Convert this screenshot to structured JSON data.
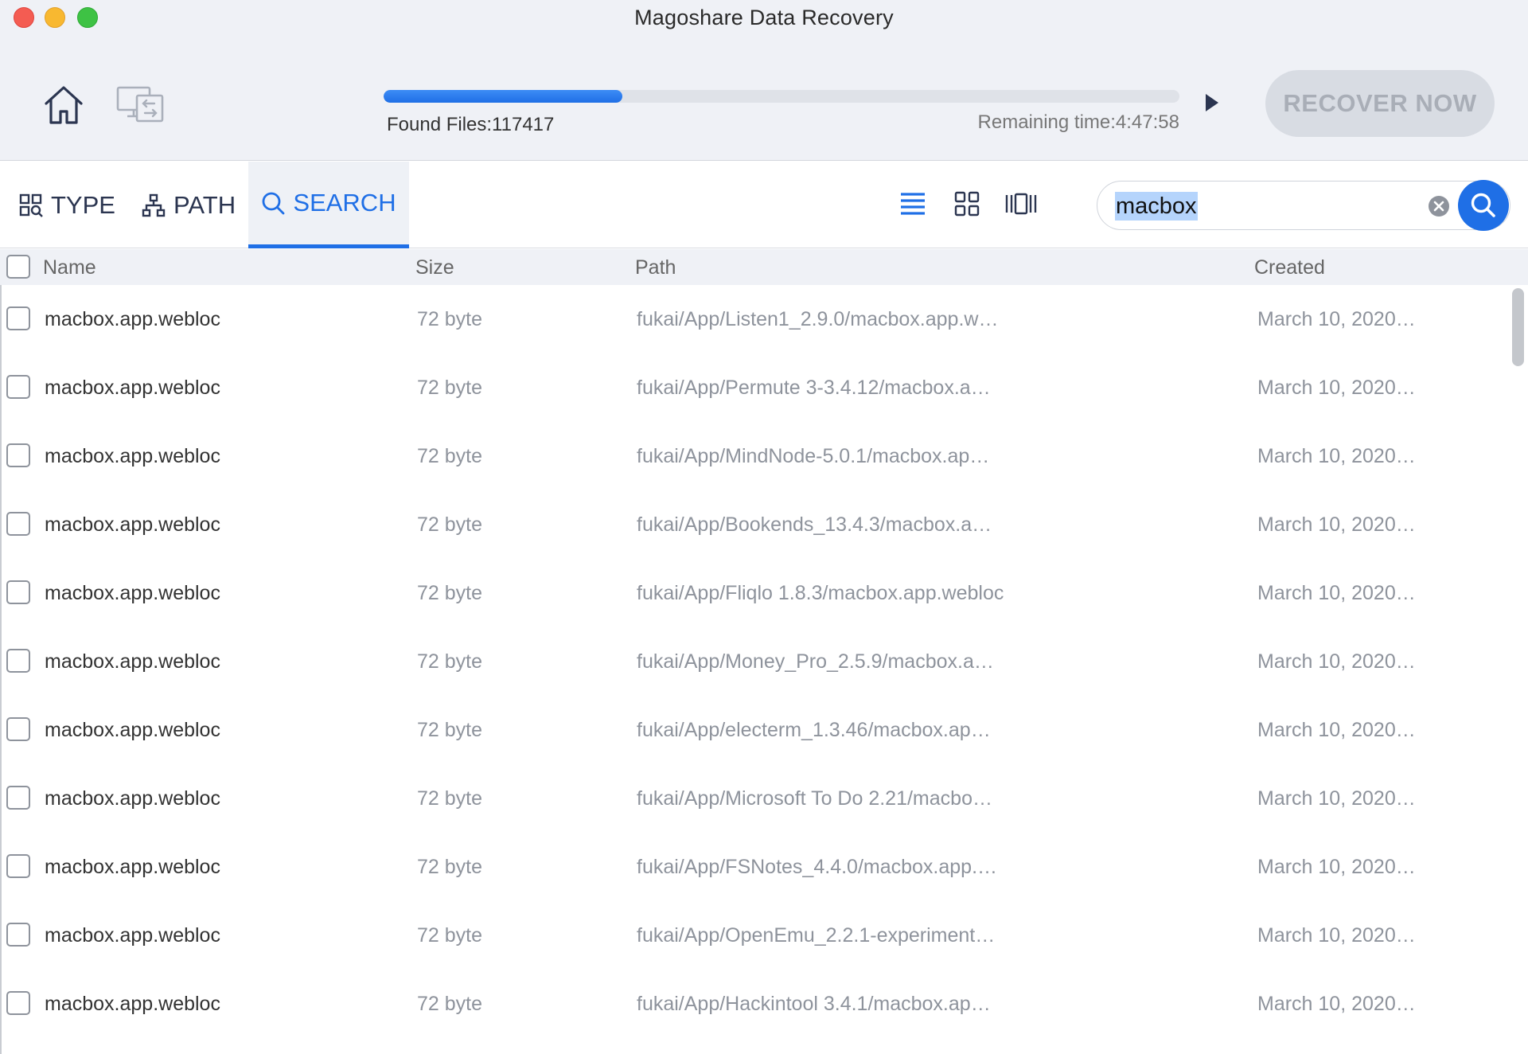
{
  "window": {
    "title": "Magoshare Data Recovery"
  },
  "header": {
    "home_icon": "home-icon",
    "switch_icon": "device-switch-icon",
    "progress": 0.3,
    "found_files": "Found Files:117417",
    "remaining_time": "Remaining time:4:47:58",
    "play_icon": "play-icon",
    "recover_label": "RECOVER NOW"
  },
  "tabs": [
    {
      "label": "TYPE",
      "icon": "type-grid-icon"
    },
    {
      "label": "PATH",
      "icon": "tree-icon"
    },
    {
      "label": "SEARCH",
      "icon": "search-icon"
    }
  ],
  "search": {
    "value": "macbox",
    "clear_icon": "clear-icon",
    "go_icon": "search-icon"
  },
  "colors": {
    "accent": "#1f6fe6",
    "header_bg": "#eff1f6",
    "muted_text": "#8e939c"
  },
  "columns": {
    "name": "Name",
    "size": "Size",
    "path": "Path",
    "created": "Created"
  },
  "rows": [
    {
      "name": "macbox.app.webloc",
      "size": "72 byte",
      "path": "fukai/App/Listen1_2.9.0/macbox.app.w…",
      "created": "March 10, 2020…"
    },
    {
      "name": "macbox.app.webloc",
      "size": "72 byte",
      "path": "fukai/App/Permute 3-3.4.12/macbox.a…",
      "created": "March 10, 2020…"
    },
    {
      "name": "macbox.app.webloc",
      "size": "72 byte",
      "path": "fukai/App/MindNode-5.0.1/macbox.ap…",
      "created": "March 10, 2020…"
    },
    {
      "name": "macbox.app.webloc",
      "size": "72 byte",
      "path": "fukai/App/Bookends_13.4.3/macbox.a…",
      "created": "March 10, 2020…"
    },
    {
      "name": "macbox.app.webloc",
      "size": "72 byte",
      "path": "fukai/App/Fliqlo 1.8.3/macbox.app.webloc",
      "created": "March 10, 2020…"
    },
    {
      "name": "macbox.app.webloc",
      "size": "72 byte",
      "path": "fukai/App/Money_Pro_2.5.9/macbox.a…",
      "created": "March 10, 2020…"
    },
    {
      "name": "macbox.app.webloc",
      "size": "72 byte",
      "path": "fukai/App/electerm_1.3.46/macbox.ap…",
      "created": "March 10, 2020…"
    },
    {
      "name": "macbox.app.webloc",
      "size": "72 byte",
      "path": "fukai/App/Microsoft To Do 2.21/macbo…",
      "created": "March 10, 2020…"
    },
    {
      "name": "macbox.app.webloc",
      "size": "72 byte",
      "path": "fukai/App/FSNotes_4.4.0/macbox.app.…",
      "created": "March 10, 2020…"
    },
    {
      "name": "macbox.app.webloc",
      "size": "72 byte",
      "path": "fukai/App/OpenEmu_2.2.1-experiment…",
      "created": "March 10, 2020…"
    },
    {
      "name": "macbox.app.webloc",
      "size": "72 byte",
      "path": "fukai/App/Hackintool 3.4.1/macbox.ap…",
      "created": "March 10, 2020…"
    }
  ]
}
